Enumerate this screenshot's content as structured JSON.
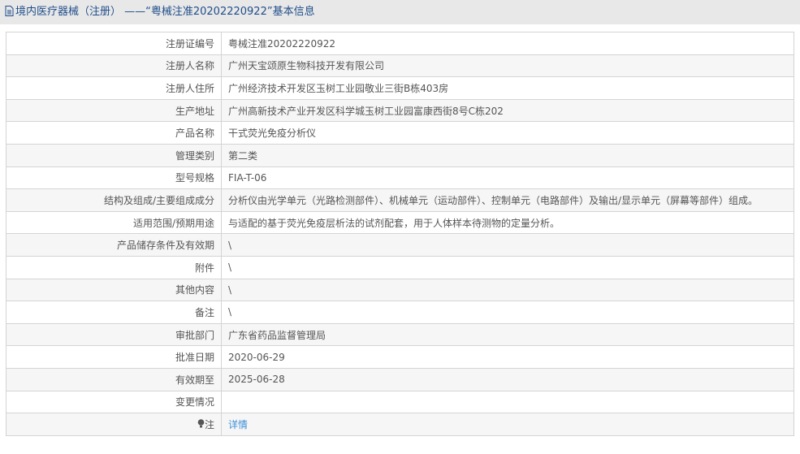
{
  "title": "境内医疗器械（注册） ——“粤械注准20202220922”基本信息",
  "rows": [
    {
      "label": "注册证编号",
      "value": "粤械注准20202220922"
    },
    {
      "label": "注册人名称",
      "value": "广州天宝颂原生物科技开发有限公司"
    },
    {
      "label": "注册人住所",
      "value": "广州经济技术开发区玉树工业园敬业三街B栋403房"
    },
    {
      "label": "生产地址",
      "value": "广州高新技术产业开发区科学城玉树工业园富康西街8号C栋202"
    },
    {
      "label": "产品名称",
      "value": "干式荧光免疫分析仪"
    },
    {
      "label": "管理类别",
      "value": "第二类"
    },
    {
      "label": "型号规格",
      "value": "FIA-T-06"
    },
    {
      "label": "结构及组成/主要组成成分",
      "value": "分析仪由光学单元（光路检测部件）、机械单元（运动部件）、控制单元（电路部件）及输出/显示单元（屏幕等部件）组成。"
    },
    {
      "label": "适用范围/预期用途",
      "value": "与适配的基于荧光免疫层析法的试剂配套，用于人体样本待测物的定量分析。"
    },
    {
      "label": "产品储存条件及有效期",
      "value": "\\"
    },
    {
      "label": "附件",
      "value": "\\"
    },
    {
      "label": "其他内容",
      "value": "\\"
    },
    {
      "label": "备注",
      "value": "\\"
    },
    {
      "label": "审批部门",
      "value": "广东省药品监督管理局"
    },
    {
      "label": "批准日期",
      "value": "2020-06-29"
    },
    {
      "label": "有效期至",
      "value": "2025-06-28"
    },
    {
      "label": "变更情况",
      "value": ""
    }
  ],
  "note": {
    "label": "注",
    "link": "详情"
  }
}
